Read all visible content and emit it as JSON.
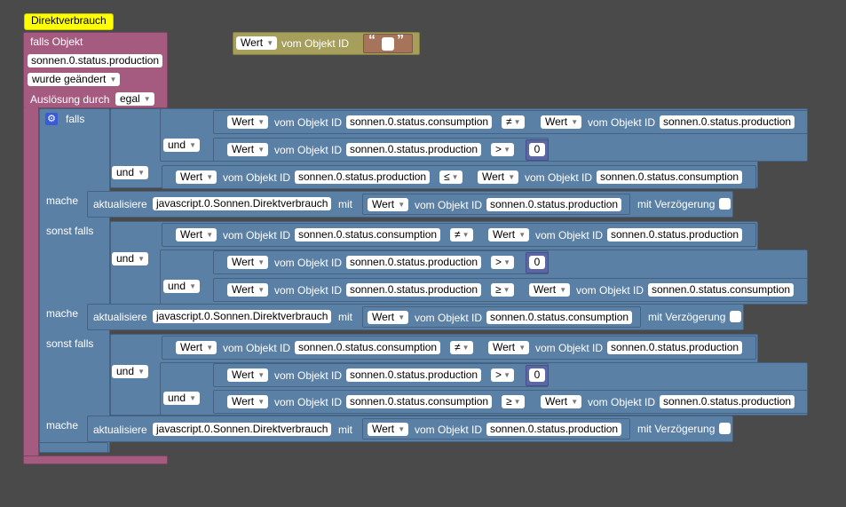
{
  "trigger": {
    "tooltip": "Direktverbrauch",
    "falls_objekt": "falls Objekt",
    "object_id": "sonnen.0.status.production",
    "wurde": "wurde geändert",
    "ausloesung_label": "Auslösung durch",
    "ausloesung_value": "egal"
  },
  "floating": {
    "wert": "Wert",
    "vom": "vom Objekt ID",
    "quote_open": "“",
    "quote_close": "”"
  },
  "labels": {
    "falls": "falls",
    "sonst_falls": "sonst falls",
    "mache": "mache",
    "und": "und",
    "wert": "Wert",
    "vom": "vom Objekt ID",
    "aktualisiere": "aktualisiere",
    "mit": "mit",
    "mit_verzoegerung": "mit Verzögerung"
  },
  "ids": {
    "consumption": "sonnen.0.status.consumption",
    "production": "sonnen.0.status.production",
    "direkt": "javascript.0.Sonnen.Direktverbrauch"
  },
  "ops": {
    "ne": "≠",
    "gt": ">",
    "le": "≤",
    "ge": "≥"
  },
  "zero": "0"
}
